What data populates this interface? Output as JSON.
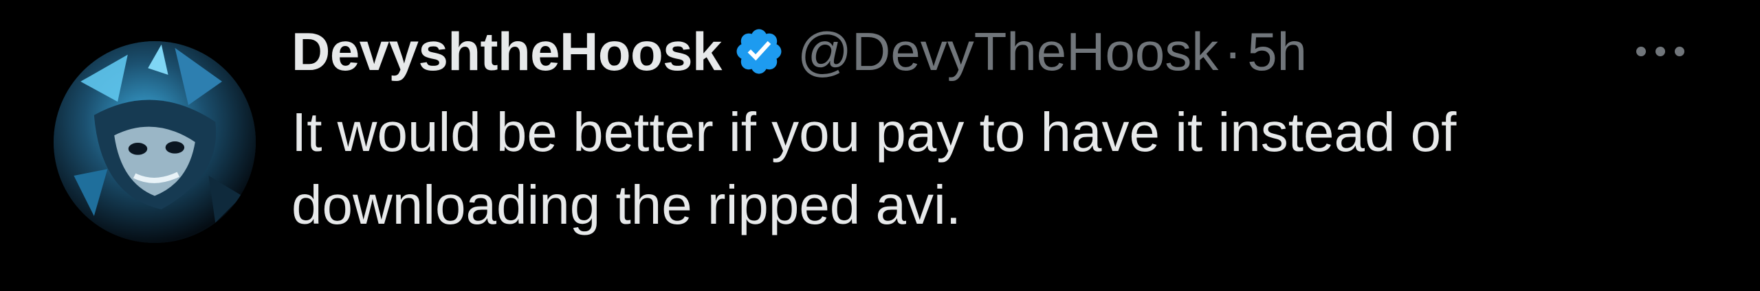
{
  "tweet": {
    "author": {
      "display_name": "DevyshtheHoosk",
      "handle": "@DevyTheHoosk",
      "verified": true,
      "avatar_icon": "avatar-blue-fox-art"
    },
    "separator": "·",
    "time": "5h",
    "more_icon": "ellipsis-icon",
    "text": "It would be better if you pay to have it instead of downloading the ripped avi."
  },
  "colors": {
    "background": "#000000",
    "primary_text": "#e7e9ea",
    "secondary_text": "#71767b",
    "verified_badge": "#1d9bf0"
  }
}
